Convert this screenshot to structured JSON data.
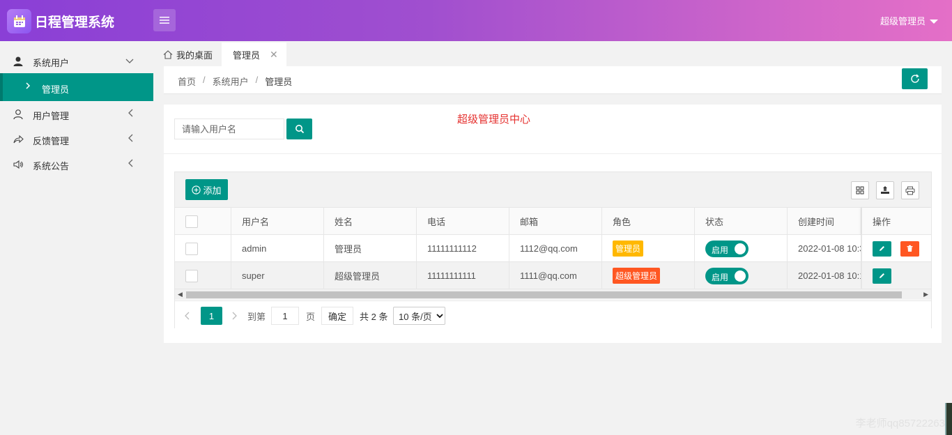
{
  "header": {
    "app_title": "日程管理系统",
    "user_label": "超级管理员",
    "logo_icon": "calendar-icon",
    "menu_icon": "hamburger-icon"
  },
  "sidebar": {
    "items": [
      {
        "label": "系统用户",
        "icon": "user-icon",
        "expanded": true
      },
      {
        "label": "用户管理",
        "icon": "user-outline-icon"
      },
      {
        "label": "反馈管理",
        "icon": "share-icon"
      },
      {
        "label": "系统公告",
        "icon": "speaker-icon"
      }
    ],
    "sub_item": {
      "label": "管理员",
      "active": true
    }
  },
  "tabs": {
    "home_label": "我的桌面",
    "active_label": "管理员",
    "close_symbol": "✕"
  },
  "breadcrumb": {
    "items": [
      "首页",
      "系统用户",
      "管理员"
    ],
    "separator": "/"
  },
  "search": {
    "placeholder": "请输入用户名",
    "value": ""
  },
  "center_title": "超级管理员中心",
  "toolbar": {
    "add_label": "添加",
    "icons": [
      "grid-columns-icon",
      "export-icon",
      "print-icon"
    ]
  },
  "table": {
    "columns": [
      "用户名",
      "姓名",
      "电话",
      "邮箱",
      "角色",
      "状态",
      "创建时间",
      "操作"
    ],
    "rows": [
      {
        "username": "admin",
        "name": "管理员",
        "phone": "11111111112",
        "email": "1112@qq.com",
        "role": "管理员",
        "role_color": "#ffb800",
        "status": "启用",
        "created": "2022-01-08 10:3",
        "actions": [
          "edit",
          "delete"
        ]
      },
      {
        "username": "super",
        "name": "超级管理员",
        "phone": "11111111111",
        "email": "1111@qq.com",
        "role": "超级管理员",
        "role_color": "#ff5722",
        "status": "启用",
        "created": "2022-01-08 10:1",
        "actions": [
          "edit"
        ]
      }
    ]
  },
  "pagination": {
    "current_page": "1",
    "goto_label": "到第",
    "goto_value": "1",
    "page_label": "页",
    "confirm_label": "确定",
    "total_label": "共 2 条",
    "page_size": "10 条/页"
  },
  "watermark": "李老师qq85722263",
  "colors": {
    "accent": "#009688",
    "danger": "#ff5722",
    "warning": "#ffb800",
    "title_red": "#e5312f"
  }
}
